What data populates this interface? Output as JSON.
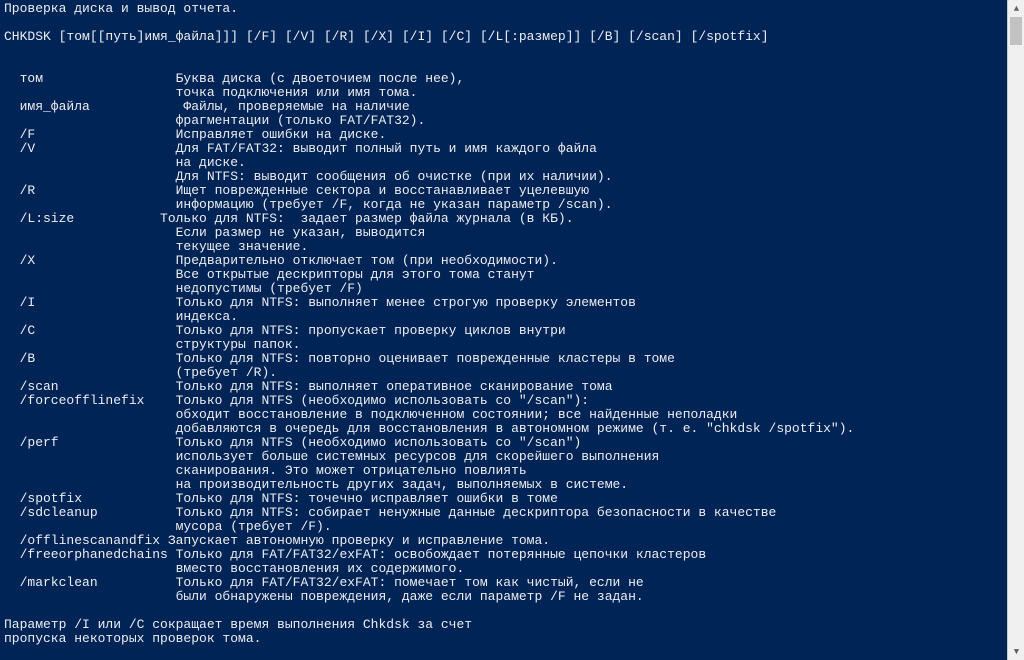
{
  "header": {
    "title_line": "Проверка диска и вывод отчета."
  },
  "syntax": "CHKDSK [том[[путь]имя_файла]]] [/F] [/V] [/R] [/X] [/I] [/C] [/L[:размер]] [/B] [/scan] [/spotfix]",
  "options": [
    {
      "flag": "  том",
      "lines": [
        "Буква диска (с двоеточием после нее),",
        "точка подключения или имя тома."
      ]
    },
    {
      "flag": "  имя_файла",
      "lines": [
        " Файлы, проверяемые на наличие",
        "фрагментации (только FAT/FAT32)."
      ]
    },
    {
      "flag": "  /F",
      "lines": [
        "Исправляет ошибки на диске."
      ]
    },
    {
      "flag": "  /V",
      "lines": [
        "Для FAT/FAT32: выводит полный путь и имя каждого файла",
        "на диске.",
        "Для NTFS: выводит сообщения об очистке (при их наличии)."
      ]
    },
    {
      "flag": "  /R",
      "lines": [
        "Ищет поврежденные сектора и восстанавливает уцелевшую",
        "информацию (требует /F, когда не указан параметр /scan)."
      ]
    },
    {
      "flag": "  /L:size",
      "lines": [
        "Только для NTFS:  задает размер файла журнала (в КБ).",
        "Если размер не указан, выводится",
        "текущее значение."
      ],
      "flag_wide": true
    },
    {
      "flag": "  /X",
      "lines": [
        "Предварительно отключает том (при необходимости).",
        "Все открытые дескрипторы для этого тома станут",
        "недопустимы (требует /F)"
      ]
    },
    {
      "flag": "  /I",
      "lines": [
        "Только для NTFS: выполняет менее строгую проверку элементов",
        "индекса."
      ]
    },
    {
      "flag": "  /C",
      "lines": [
        "Только для NTFS: пропускает проверку циклов внутри",
        "структуры папок."
      ]
    },
    {
      "flag": "  /B",
      "lines": [
        "Только для NTFS: повторно оценивает поврежденные кластеры в томе",
        "(требует /R)."
      ]
    },
    {
      "flag": "  /scan",
      "lines": [
        "Только для NTFS: выполняет оперативное сканирование тома"
      ]
    },
    {
      "flag": "  /forceofflinefix",
      "lines": [
        "Только для NTFS (необходимо использовать со \"/scan\"):",
        "обходит восстановление в подключенном состоянии; все найденные неполадки",
        "добавляются в очередь для восстановления в автономном режиме (т. е. \"chkdsk /spotfix\")."
      ]
    },
    {
      "flag": "  /perf",
      "lines": [
        "Только для NTFS (необходимо использовать со \"/scan\")",
        "использует больше системных ресурсов для скорейшего выполнения",
        "сканирования. Это может отрицательно повлиять",
        "на производительность других задач, выполняемых в системе."
      ]
    },
    {
      "flag": "  /spotfix",
      "lines": [
        "Только для NTFS: точечно исправляет ошибки в томе"
      ]
    },
    {
      "flag": "  /sdcleanup",
      "lines": [
        "Только для NTFS: собирает ненужные данные дескриптора безопасности в качестве",
        "мусора (требует /F)."
      ]
    },
    {
      "flag": "  /offlinescanandfix",
      "lines": [
        "Запускает автономную проверку и исправление тома."
      ],
      "tight": true
    },
    {
      "flag": "  /freeorphanedchains",
      "lines": [
        "Только для FAT/FAT32/exFAT: освобождает потерянные цепочки кластеров",
        "вместо восстановления их содержимого."
      ],
      "tight": true
    },
    {
      "flag": "  /markclean",
      "lines": [
        "Только для FAT/FAT32/exFAT: помечает том как чистый, если не",
        "были обнаружены повреждения, даже если параметр /F не задан."
      ]
    }
  ],
  "footer": [
    "Параметр /I или /C сокращает время выполнения Chkdsk за счет",
    "пропуска некоторых проверок тома."
  ],
  "scrollbar": {
    "up": "▲",
    "down": "▼"
  }
}
